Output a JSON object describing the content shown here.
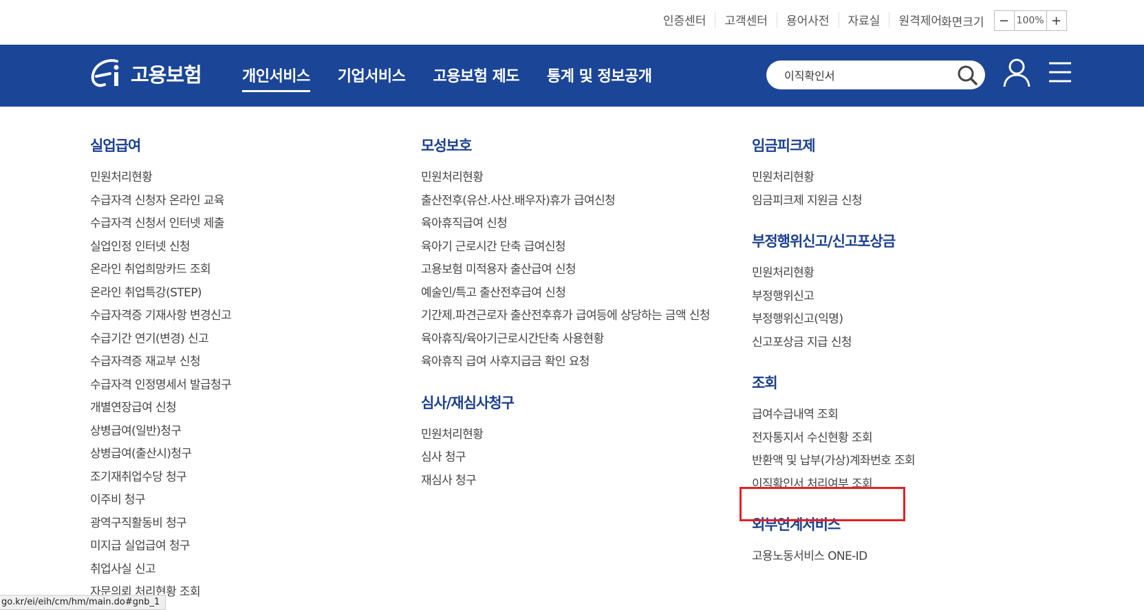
{
  "util_bar": {
    "links": [
      "인증센터",
      "고객센터",
      "용어사전",
      "자료실",
      "원격제어"
    ],
    "zoom_label": "화면크기",
    "zoom_minus": "−",
    "zoom_value": "100%",
    "zoom_plus": "+"
  },
  "nav": {
    "logo_text": "고용보험",
    "items": [
      "개인서비스",
      "기업서비스",
      "고용보험 제도",
      "통계 및 정보공개"
    ],
    "active_index": 0,
    "search_value": "이직확인서",
    "brand_color": "#1b4597",
    "icons": {
      "search": "search-icon",
      "user": "user-icon",
      "menu": "hamburger-menu-icon"
    }
  },
  "menu": {
    "col1": {
      "title": "실업급여",
      "items": [
        "민원처리현황",
        "수급자격 신청자 온라인 교육",
        "수급자격 신청서 인터넷 제출",
        "실업인정 인터넷 신청",
        "온라인 취업희망카드 조회",
        "온라인 취업특강(STEP)",
        "수급자격증 기재사항 변경신고",
        "수급기간 연기(변경) 신고",
        "수급자격증 재교부 신청",
        "수급자격 인정명세서 발급청구",
        "개별연장급여 신청",
        "상병급여(일반)청구",
        "상병급여(출산시)청구",
        "조기재취업수당 청구",
        "이주비 청구",
        "광역구직활동비 청구",
        "미지급 실업급여 청구",
        "취업사실 신고",
        "자문의뢰 처리현황 조회"
      ]
    },
    "col2": [
      {
        "title": "모성보호",
        "items": [
          "민원처리현황",
          "출산전후(유산.사산.배우자)휴가 급여신청",
          "육아휴직급여 신청",
          "육아기 근로시간 단축 급여신청",
          "고용보험 미적용자 출산급여 신청",
          "예술인/특고 출산전후급여 신청",
          "기간제.파견근로자 출산전후휴가 급여등에 상당하는 금액 신청",
          "육아휴직/육아기근로시간단축 사용현황",
          "육아휴직 급여 사후지급금 확인 요청"
        ]
      },
      {
        "title": "심사/재심사청구",
        "items": [
          "민원처리현황",
          "심사 청구",
          "재심사 청구"
        ]
      }
    ],
    "col3": [
      {
        "title": "임금피크제",
        "items": [
          "민원처리현황",
          "임금피크제 지원금 신청"
        ]
      },
      {
        "title": "부정행위신고/신고포상금",
        "items": [
          "민원처리현황",
          "부정행위신고",
          "부정행위신고(익명)",
          "신고포상금 지급 신청"
        ]
      },
      {
        "title": "조회",
        "items": [
          "급여수급내역 조회",
          "전자통지서 수신현황 조회",
          "반환액 및 납부(가상)계좌번호 조회",
          "이직확인서 처리여부 조회"
        ]
      },
      {
        "title": "외부연계서비스",
        "items": [
          "고용노동서비스 ONE-ID"
        ]
      }
    ],
    "highlight_color": "#e61e26"
  },
  "status_bar": {
    "url": "go.kr/ei/eih/cm/hm/main.do#gnb_1"
  }
}
